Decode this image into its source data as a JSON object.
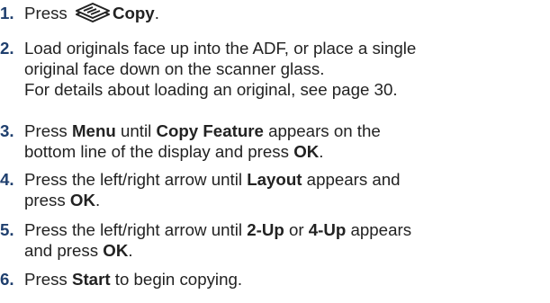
{
  "steps": [
    {
      "number": "1.",
      "text_a": "Press",
      "icon": "copy-button-icon",
      "bold_a": "Copy",
      "text_b": "."
    },
    {
      "number": "2.",
      "line1": "Load originals face up into the ADF, or place a single",
      "line2": "original face down on the scanner glass.",
      "line3": "For details about loading an original, see page 30."
    },
    {
      "number": "3.",
      "text_a": "Press",
      "bold_a": "Menu",
      "text_b": "until",
      "bold_b": "Copy Feature",
      "text_c": "appears on the",
      "line2_text": "bottom line of the display and press",
      "bold_c": "OK",
      "text_d": "."
    },
    {
      "number": "4.",
      "text_a": "Press the left/right arrow until",
      "bold_a": "Layout",
      "text_b": "appears and",
      "line2_text": "press",
      "bold_b": "OK",
      "text_c": "."
    },
    {
      "number": "5.",
      "text_a": "Press the left/right arrow until",
      "bold_a": "2-Up",
      "text_b": "or",
      "bold_b": "4-Up",
      "text_c": "appears",
      "line2_text": "and press",
      "bold_c": "OK",
      "text_d": "."
    },
    {
      "number": "6.",
      "text_a": "Press",
      "bold_a": "Start",
      "text_b": "to begin copying."
    }
  ],
  "colors": {
    "number": "#1f3f6e",
    "text": "#222222"
  }
}
